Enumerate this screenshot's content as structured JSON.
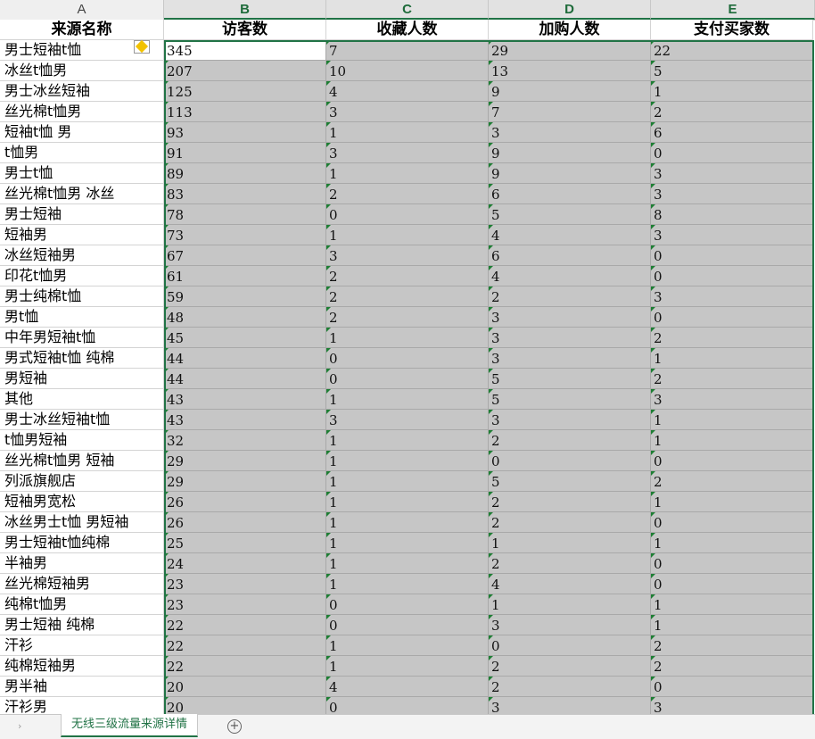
{
  "column_letters": [
    "A",
    "B",
    "C",
    "D",
    "E"
  ],
  "headers": [
    "来源名称",
    "访客数",
    "收藏人数",
    "加购人数",
    "支付买家数"
  ],
  "rows": [
    [
      "男士短袖t恤",
      "345",
      "7",
      "29",
      "22"
    ],
    [
      "冰丝t恤男",
      "207",
      "10",
      "13",
      "5"
    ],
    [
      "男士冰丝短袖",
      "125",
      "4",
      "9",
      "1"
    ],
    [
      "丝光棉t恤男",
      "113",
      "3",
      "7",
      "2"
    ],
    [
      "短袖t恤 男",
      "93",
      "1",
      "3",
      "6"
    ],
    [
      "t恤男",
      "91",
      "3",
      "9",
      "0"
    ],
    [
      "男士t恤",
      "89",
      "1",
      "9",
      "3"
    ],
    [
      "丝光棉t恤男 冰丝",
      "83",
      "2",
      "6",
      "3"
    ],
    [
      "男士短袖",
      "78",
      "0",
      "5",
      "8"
    ],
    [
      "短袖男",
      "73",
      "1",
      "4",
      "3"
    ],
    [
      "冰丝短袖男",
      "67",
      "3",
      "6",
      "0"
    ],
    [
      "印花t恤男",
      "61",
      "2",
      "4",
      "0"
    ],
    [
      "男士纯棉t恤",
      "59",
      "2",
      "2",
      "3"
    ],
    [
      "男t恤",
      "48",
      "2",
      "3",
      "0"
    ],
    [
      "中年男短袖t恤",
      "45",
      "1",
      "3",
      "2"
    ],
    [
      "男式短袖t恤 纯棉",
      "44",
      "0",
      "3",
      "1"
    ],
    [
      "男短袖",
      "44",
      "0",
      "5",
      "2"
    ],
    [
      "其他",
      "43",
      "1",
      "5",
      "3"
    ],
    [
      "男士冰丝短袖t恤",
      "43",
      "3",
      "3",
      "1"
    ],
    [
      "t恤男短袖",
      "32",
      "1",
      "2",
      "1"
    ],
    [
      "丝光棉t恤男 短袖",
      "29",
      "1",
      "0",
      "0"
    ],
    [
      "列派旗舰店",
      "29",
      "1",
      "5",
      "2"
    ],
    [
      "短袖男宽松",
      "26",
      "1",
      "2",
      "1"
    ],
    [
      "冰丝男士t恤 男短袖",
      "26",
      "1",
      "2",
      "0"
    ],
    [
      "男士短袖t恤纯棉",
      "25",
      "1",
      "1",
      "1"
    ],
    [
      "半袖男",
      "24",
      "1",
      "2",
      "0"
    ],
    [
      "丝光棉短袖男",
      "23",
      "1",
      "4",
      "0"
    ],
    [
      "纯棉t恤男",
      "23",
      "0",
      "1",
      "1"
    ],
    [
      "男士短袖 纯棉",
      "22",
      "0",
      "3",
      "1"
    ],
    [
      "汗衫",
      "22",
      "1",
      "0",
      "2"
    ],
    [
      "纯棉短袖男",
      "22",
      "1",
      "2",
      "2"
    ],
    [
      "男半袖",
      "20",
      "4",
      "2",
      "0"
    ],
    [
      "汗衫男",
      "20",
      "0",
      "3",
      "3"
    ]
  ],
  "sheet_tab": "无线三级流量来源详情",
  "add_sheet_label": "+",
  "scroll_label": "›",
  "colors": {
    "accent": "#217346",
    "selection_fill": "#c6c6c6"
  },
  "icons": [
    "error-warning-icon",
    "add-sheet-icon",
    "scroll-left-icon"
  ]
}
